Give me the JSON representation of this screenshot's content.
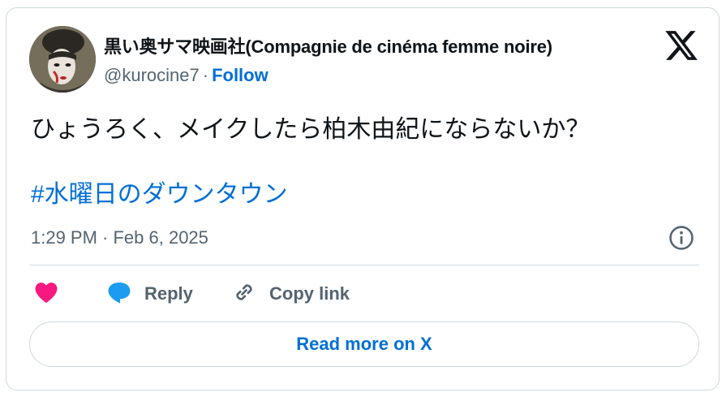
{
  "author": {
    "display_name": "黒い奥サマ映画社(Compagnie de cinéma femme noire)",
    "handle": "@kurocine7",
    "separator": "·",
    "follow_label": "Follow"
  },
  "tweet": {
    "text": "ひょうろく、メイクしたら柏木由紀にならないか？",
    "hashtag": "#水曜日のダウンタウン",
    "timestamp": "1:29 PM · Feb 6, 2025"
  },
  "actions": {
    "reply_label": "Reply",
    "copy_link_label": "Copy link"
  },
  "read_more_label": "Read more on X",
  "icons": {
    "brand": "x-logo-icon",
    "info": "info-icon",
    "like": "heart-icon",
    "reply": "speech-bubble-icon",
    "copy": "link-icon"
  },
  "colors": {
    "accent": "#006fd6",
    "like": "#f91880",
    "reply": "#1d9bf0",
    "muted": "#536471",
    "border": "#cfd9de"
  }
}
